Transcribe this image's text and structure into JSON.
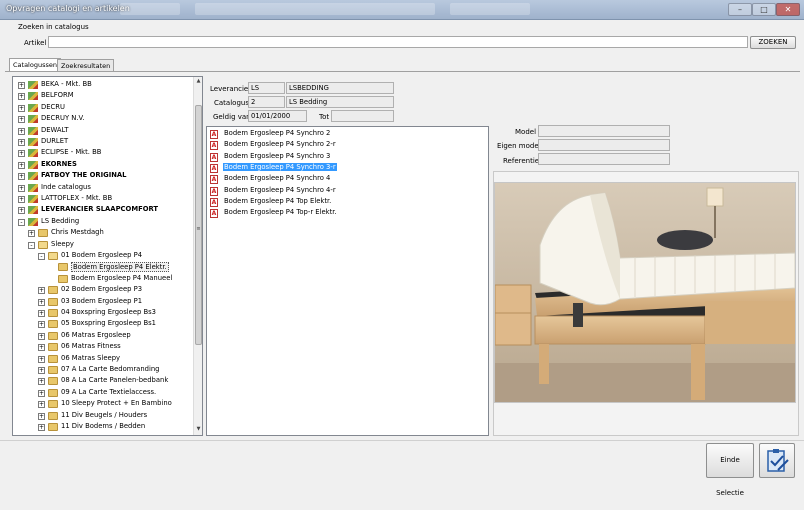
{
  "window": {
    "title": "Opvragen catalogi en artikelen"
  },
  "search": {
    "section_label": "Zoeken in catalogus",
    "field_label": "Artikel",
    "value": "",
    "button_label": "ZOEKEN"
  },
  "tabs": [
    {
      "label": "Catalogussen",
      "active": true
    },
    {
      "label": "Zoekresultaten",
      "active": false
    }
  ],
  "tree": [
    {
      "label": "BEKA - Mkt. BB",
      "level": 0,
      "expander": "+",
      "icon": "supplier-icon",
      "bold": false
    },
    {
      "label": "BELFORM",
      "level": 0,
      "expander": "+",
      "icon": "supplier-icon",
      "bold": false
    },
    {
      "label": "DECRU",
      "level": 0,
      "expander": "+",
      "icon": "supplier-icon",
      "bold": false
    },
    {
      "label": "DECRUY N.V.",
      "level": 0,
      "expander": "+",
      "icon": "supplier-icon",
      "bold": false
    },
    {
      "label": "DEWALT",
      "level": 0,
      "expander": "+",
      "icon": "supplier-icon",
      "bold": false
    },
    {
      "label": "DURLET",
      "level": 0,
      "expander": "+",
      "icon": "supplier-icon",
      "bold": false
    },
    {
      "label": "ECLIPSE - Mkt. BB",
      "level": 0,
      "expander": "+",
      "icon": "supplier-icon",
      "bold": false
    },
    {
      "label": "EKORNES",
      "level": 0,
      "expander": "+",
      "icon": "supplier-icon",
      "bold": true
    },
    {
      "label": "FATBOY THE ORIGINAL",
      "level": 0,
      "expander": "+",
      "icon": "supplier-icon",
      "bold": true
    },
    {
      "label": "Inde catalogus",
      "level": 0,
      "expander": "+",
      "icon": "supplier-icon",
      "bold": false
    },
    {
      "label": "LATTOFLEX - Mkt. BB",
      "level": 0,
      "expander": "+",
      "icon": "supplier-icon",
      "bold": false
    },
    {
      "label": "LEVERANCIER SLAAPCOMFORT",
      "level": 0,
      "expander": "+",
      "icon": "supplier-icon",
      "bold": true
    },
    {
      "label": "LS Bedding",
      "level": 0,
      "expander": "-",
      "icon": "supplier-icon",
      "bold": false
    },
    {
      "label": "Chris Mestdagh",
      "level": 1,
      "expander": "+",
      "icon": "folder-icon",
      "bold": false
    },
    {
      "label": "Sleepy",
      "level": 1,
      "expander": "-",
      "icon": "folder-open-icon",
      "bold": false
    },
    {
      "label": "01 Bodem Ergosleep P4",
      "level": 2,
      "expander": "-",
      "icon": "folder-open-icon",
      "bold": false
    },
    {
      "label": "Bodem Ergosleep P4 Elektr.",
      "level": 3,
      "expander": "",
      "icon": "folder-icon",
      "bold": false,
      "selected": true
    },
    {
      "label": "Bodem Ergosleep P4 Manueel",
      "level": 3,
      "expander": "",
      "icon": "folder-icon",
      "bold": false
    },
    {
      "label": "02 Bodem Ergosleep P3",
      "level": 2,
      "expander": "+",
      "icon": "folder-icon",
      "bold": false
    },
    {
      "label": "03 Bodem Ergosleep P1",
      "level": 2,
      "expander": "+",
      "icon": "folder-icon",
      "bold": false
    },
    {
      "label": "04 Boxspring Ergosleep Bs3",
      "level": 2,
      "expander": "+",
      "icon": "folder-icon",
      "bold": false
    },
    {
      "label": "05 Boxspring Ergosleep Bs1",
      "level": 2,
      "expander": "+",
      "icon": "folder-icon",
      "bold": false
    },
    {
      "label": "06 Matras Ergosleep",
      "level": 2,
      "expander": "+",
      "icon": "folder-icon",
      "bold": false
    },
    {
      "label": "06 Matras Fitness",
      "level": 2,
      "expander": "+",
      "icon": "folder-icon",
      "bold": false
    },
    {
      "label": "06 Matras Sleepy",
      "level": 2,
      "expander": "+",
      "icon": "folder-icon",
      "bold": false
    },
    {
      "label": "07 A La Carte Bedomranding",
      "level": 2,
      "expander": "+",
      "icon": "folder-icon",
      "bold": false
    },
    {
      "label": "08 A La Carte Panelen-bedbank",
      "level": 2,
      "expander": "+",
      "icon": "folder-icon",
      "bold": false
    },
    {
      "label": "09 A La Carte Textielaccess.",
      "level": 2,
      "expander": "+",
      "icon": "folder-icon",
      "bold": false
    },
    {
      "label": "10 Sleepy Protect + En Bambino",
      "level": 2,
      "expander": "+",
      "icon": "folder-icon",
      "bold": false
    },
    {
      "label": "11 Div Beugels / Houders",
      "level": 2,
      "expander": "+",
      "icon": "folder-icon",
      "bold": false
    },
    {
      "label": "11 Div Bodems / Bedden",
      "level": 2,
      "expander": "+",
      "icon": "folder-icon",
      "bold": false
    }
  ],
  "info": {
    "leverancier_label": "Leverancier",
    "leverancier_code": "LS",
    "leverancier_name": "LSBEDDING",
    "catalogus_label": "Catalogus",
    "catalogus_code": "2",
    "catalogus_name": "LS Bedding",
    "geldig_label": "Geldig van",
    "geldig_value": "01/01/2000",
    "tot_label": "Tot",
    "tot_value": ""
  },
  "articles": [
    {
      "label": "Bodem Ergosleep P4 Synchro 2",
      "selected": false
    },
    {
      "label": "Bodem Ergosleep P4 Synchro 2-r",
      "selected": false
    },
    {
      "label": "Bodem Ergosleep P4 Synchro 3",
      "selected": false
    },
    {
      "label": "Bodem Ergosleep P4 Synchro 3-r",
      "selected": true
    },
    {
      "label": "Bodem Ergosleep P4 Synchro 4",
      "selected": false
    },
    {
      "label": "Bodem Ergosleep P4 Synchro 4-r",
      "selected": false
    },
    {
      "label": "Bodem Ergosleep P4 Top Elektr.",
      "selected": false
    },
    {
      "label": "Bodem Ergosleep P4 Top-r Elektr.",
      "selected": false
    }
  ],
  "detail": {
    "model_label": "Model",
    "model_value": "",
    "eigen_model_label": "Eigen model",
    "eigen_model_value": "",
    "referentie_label": "Referentie",
    "referentie_value": ""
  },
  "footer": {
    "einde_selectie_label": "Einde Selectie"
  },
  "colors": {
    "selection": "#3399ff",
    "titlebar": "#b9c9de"
  }
}
